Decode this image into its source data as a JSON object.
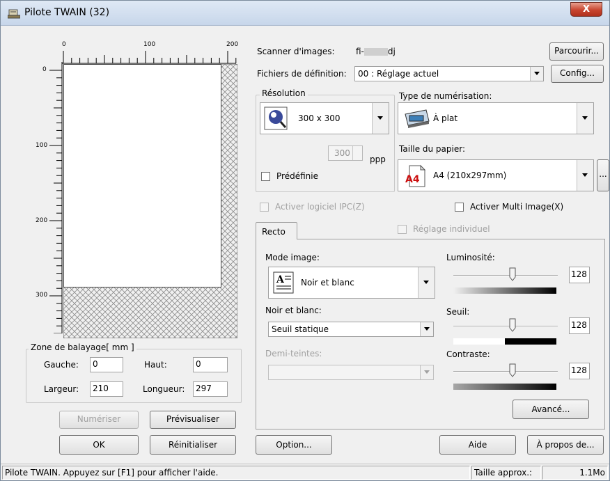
{
  "window": {
    "title": "Pilote TWAIN (32)",
    "close_label": "X"
  },
  "ruler": {
    "h_labels": [
      "0",
      "100",
      "200"
    ],
    "v_labels": [
      "0",
      "100",
      "200",
      "300"
    ]
  },
  "scan_area": {
    "group_label": "Zone de balayage[ mm ]",
    "left_label": "Gauche:",
    "left_value": "0",
    "top_label": "Haut:",
    "top_value": "0",
    "width_label": "Largeur:",
    "width_value": "210",
    "length_label": "Longueur:",
    "length_value": "297"
  },
  "buttons": {
    "scan": "Numériser",
    "preview": "Prévisualiser",
    "ok": "OK",
    "reset": "Réinitialiser",
    "browse": "Parcourir...",
    "config": "Config...",
    "option": "Option...",
    "help": "Aide",
    "about": "À propos de...",
    "advanced": "Avancé...",
    "paper_more": "..."
  },
  "scanner": {
    "label": "Scanner d'images:",
    "value_prefix": "fi-",
    "value_suffix": "dj"
  },
  "definition": {
    "label": "Fichiers de définition:",
    "value": "00 : Réglage actuel"
  },
  "resolution": {
    "group_label": "Résolution",
    "value": "300 x 300",
    "custom_value": "300",
    "unit": "ppp",
    "preset_label": "Prédéfinie"
  },
  "scan_type": {
    "label": "Type de numérisation:",
    "value": "À plat"
  },
  "paper_size": {
    "label": "Taille du papier:",
    "value": "A4 (210x297mm)",
    "icon_text": "A4"
  },
  "checkboxes": {
    "ipc": "Activer logiciel IPC(Z)",
    "multi_image": "Activer Multi Image(X)",
    "individual": "Réglage individuel"
  },
  "tab": {
    "label": "Recto"
  },
  "image_mode": {
    "label": "Mode image:",
    "value": "Noir et blanc"
  },
  "bw": {
    "label": "Noir et blanc:",
    "value": "Seuil statique"
  },
  "halftone": {
    "label": "Demi-teintes:",
    "value": ""
  },
  "brightness": {
    "label": "Luminosité:",
    "value": "128",
    "level": 0.5
  },
  "threshold": {
    "label": "Seuil:",
    "value": "128",
    "level": 0.5
  },
  "contrast": {
    "label": "Contraste:",
    "value": "128",
    "level": 0.5
  },
  "status": {
    "help_text": "Pilote TWAIN. Appuyez sur [F1] pour afficher l'aide.",
    "size_label": "Taille approx.:",
    "size_value": "1.1Mo"
  }
}
